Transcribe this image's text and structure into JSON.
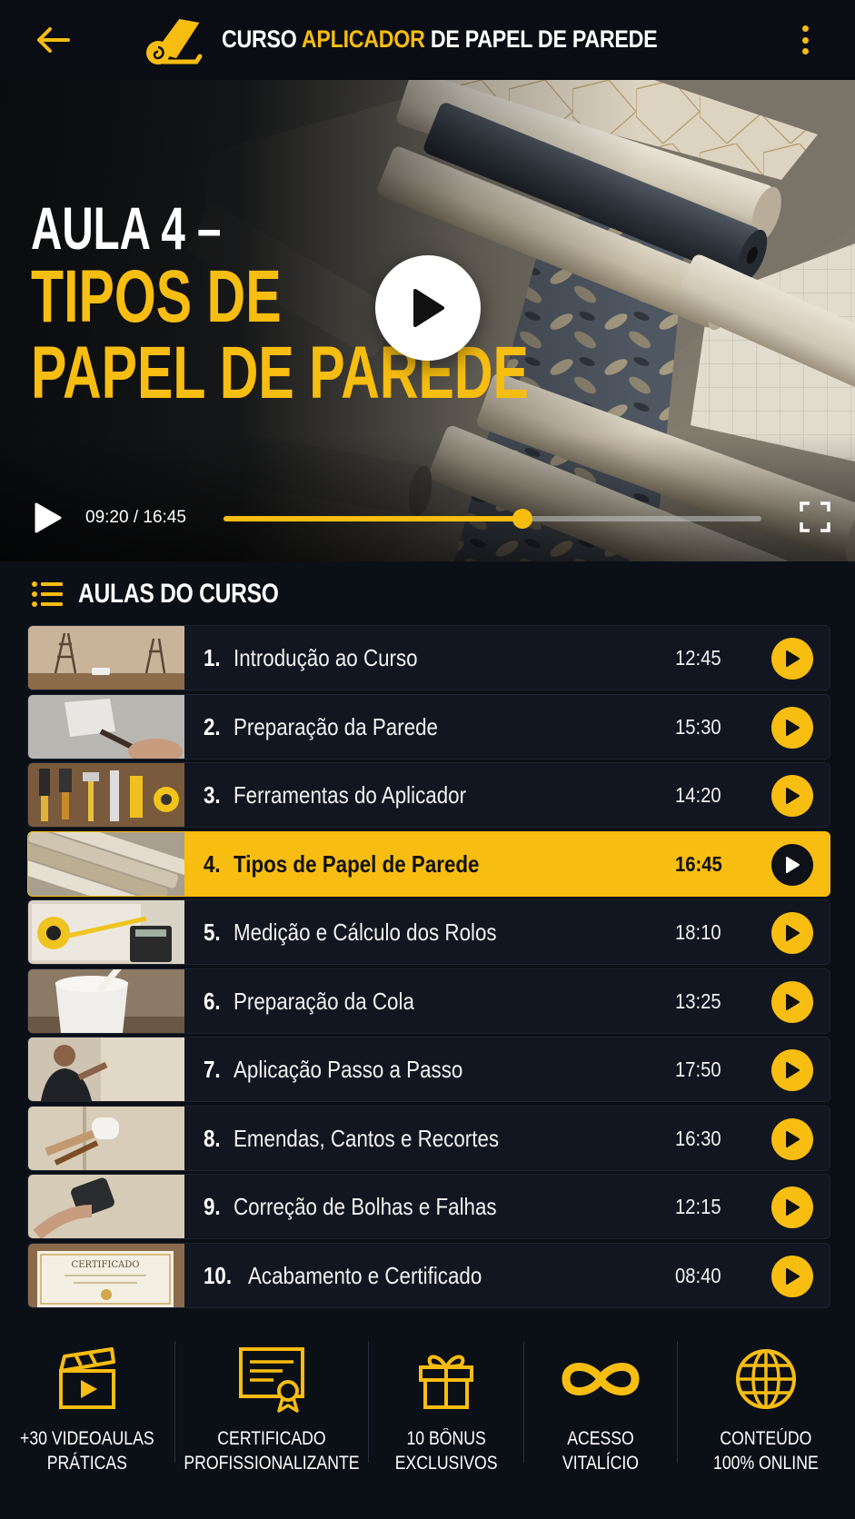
{
  "header": {
    "title_part1": "CURSO ",
    "title_accent": "APLICADOR",
    "title_part2": " DE PAPEL DE PAREDE"
  },
  "video": {
    "heading_line1": "AULA 4 –",
    "heading_line2": "TIPOS DE",
    "heading_line3": "PAPEL DE PAREDE",
    "time": "09:20 / 16:45",
    "progress_fraction": 0.556
  },
  "lessons_section": {
    "title": "AULAS DO CURSO"
  },
  "lessons": [
    {
      "num": "1.",
      "title": "Introdução ao Curso",
      "duration": "12:45"
    },
    {
      "num": "2.",
      "title": "Preparação da Parede",
      "duration": "15:30"
    },
    {
      "num": "3.",
      "title": "Ferramentas do Aplicador",
      "duration": "14:20"
    },
    {
      "num": "4.",
      "title": "Tipos de Papel de Parede",
      "duration": "16:45"
    },
    {
      "num": "5.",
      "title": "Medição e Cálculo dos Rolos",
      "duration": "18:10"
    },
    {
      "num": "6.",
      "title": "Preparação da Cola",
      "duration": "13:25"
    },
    {
      "num": "7.",
      "title": "Aplicação Passo a Passo",
      "duration": "17:50"
    },
    {
      "num": "8.",
      "title": "Emendas, Cantos e Recortes",
      "duration": "16:30"
    },
    {
      "num": "9.",
      "title": "Correção de Bolhas e Falhas",
      "duration": "12:15"
    },
    {
      "num": "10.",
      "title": "Acabamento e Certificado",
      "duration": "08:40"
    }
  ],
  "thumb_certificate_text": "CERTIFICADO",
  "features": [
    {
      "line1": "+30 VIDEOAULAS",
      "line2": "PRÁTICAS",
      "icon": "clapperboard-icon"
    },
    {
      "line1": "CERTIFICADO",
      "line2": "PROFISSIONALIZANTE",
      "icon": "certificate-icon"
    },
    {
      "line1": "10 BÔNUS",
      "line2": "EXCLUSIVOS",
      "icon": "gift-icon"
    },
    {
      "line1": "ACESSO",
      "line2": "VITALÍCIO",
      "icon": "infinity-icon"
    },
    {
      "line1": "CONTEÚDO",
      "line2": "100% ONLINE",
      "icon": "globe-icon"
    }
  ],
  "colors": {
    "accent": "#f7bd10",
    "background": "#0b0f16",
    "row_background": "#111620"
  }
}
